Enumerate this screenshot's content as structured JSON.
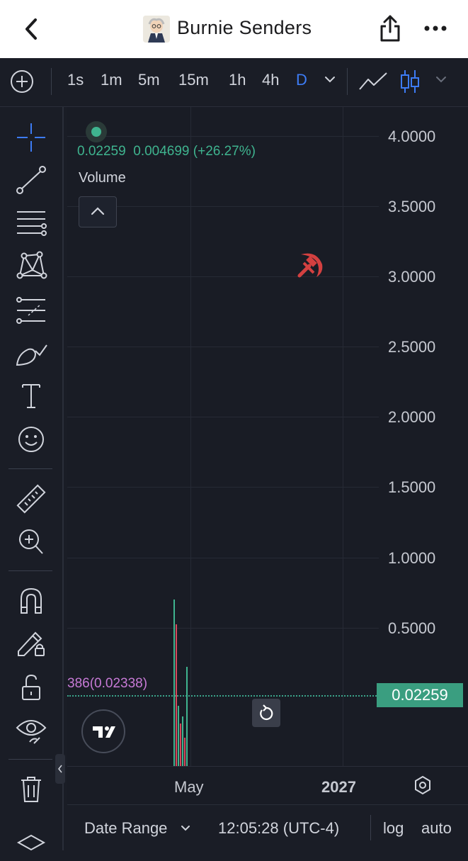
{
  "header": {
    "title": "Burnie Senders"
  },
  "toolbar": {
    "timeframes": [
      "1s",
      "1m",
      "5m",
      "15m",
      "1h",
      "4h",
      "D"
    ],
    "active_timeframe": "D"
  },
  "legend": {
    "price": "0.02259",
    "change": "0.004699",
    "change_pct": "(+26.27%)",
    "volume_label": "Volume"
  },
  "y_axis": [
    "4.0000",
    "3.5000",
    "3.0000",
    "2.5000",
    "2.0000",
    "1.5000",
    "1.0000",
    "0.5000"
  ],
  "price_tag": "0.02259",
  "overlapping_label": "386(0.02338)",
  "x_axis": {
    "label_1": "May",
    "label_2": "2027"
  },
  "bottom_bar": {
    "date_range": "Date Range",
    "time": "12:05:28 (UTC-4)",
    "log": "log",
    "auto": "auto"
  },
  "colors": {
    "up": "#3fb48f",
    "down": "#d6495c",
    "accent": "#3d7cf5",
    "background": "#191c25"
  },
  "icons": [
    "back-icon",
    "share-icon",
    "more-icon",
    "crosshair-icon",
    "trend-line-icon",
    "fib-icon",
    "pattern-icon",
    "projection-icon",
    "brush-icon",
    "text-icon",
    "emoji-icon",
    "ruler-icon",
    "zoom-in-icon",
    "magnet-icon",
    "lock-pencil-icon",
    "unlock-icon",
    "eye-icon",
    "trash-icon",
    "layers-icon"
  ]
}
